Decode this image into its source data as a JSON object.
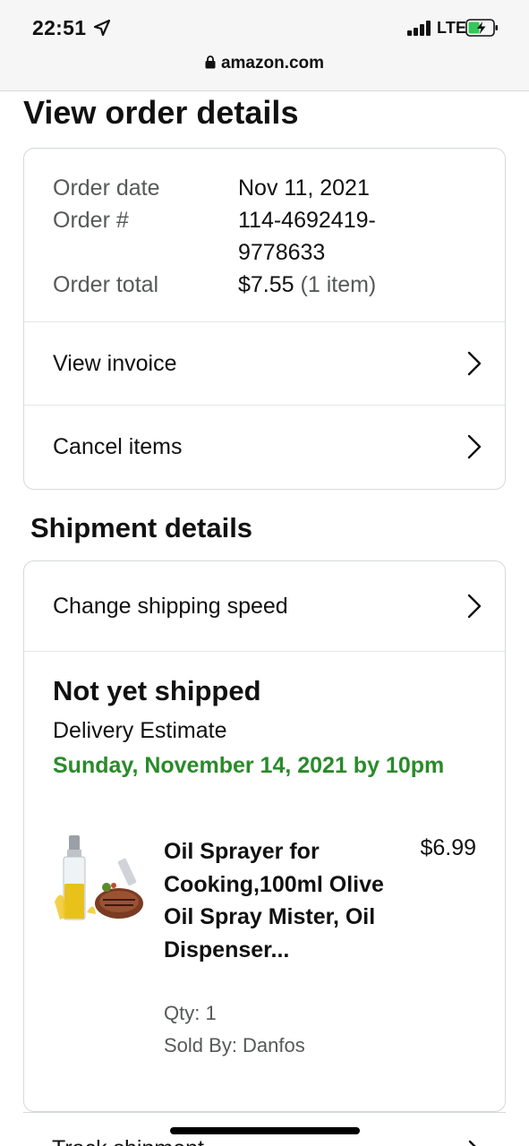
{
  "status_bar": {
    "time": "22:51",
    "network": "LTE"
  },
  "browser": {
    "url": "amazon.com"
  },
  "page": {
    "title": "View order details"
  },
  "order_summary": {
    "rows": [
      {
        "label": "Order date",
        "value": "Nov 11, 2021",
        "extra": ""
      },
      {
        "label": "Order #",
        "value": "114-4692419-9778633",
        "value_line1": "114-4692419-",
        "value_line2": "9778633",
        "extra": ""
      },
      {
        "label": "Order total",
        "value": "$7.55",
        "extra": "(1 item)"
      }
    ],
    "links": [
      {
        "label": "View invoice"
      },
      {
        "label": "Cancel items"
      }
    ]
  },
  "shipment": {
    "section_title": "Shipment details",
    "change_speed_label": "Change shipping speed",
    "status": "Not yet shipped",
    "delivery_label": "Delivery Estimate",
    "delivery_date": "Sunday, November 14, 2021 by 10pm",
    "item": {
      "title": "Oil Sprayer for Cooking,100ml Olive Oil Spray Mister, Oil Dispenser...",
      "price": "$6.99",
      "qty": "Qty: 1",
      "sold_by": "Sold By: Danfos"
    }
  },
  "next_row": {
    "label": "Track shipment"
  },
  "colors": {
    "delivery_green": "#2a8a2a",
    "muted_text": "#565959",
    "border": "#d5d9d9"
  }
}
